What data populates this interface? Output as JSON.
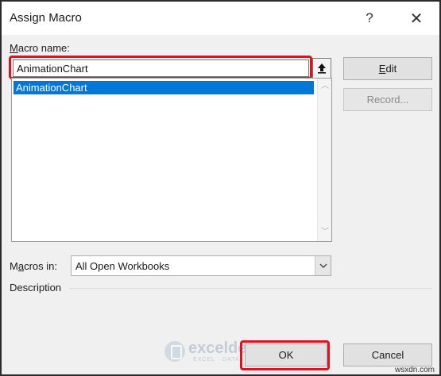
{
  "window": {
    "title": "Assign Macro",
    "help_glyph": "?",
    "close_glyph": "✕"
  },
  "macro_name": {
    "label": "Macro name:",
    "label_access_key": "M",
    "label_rest": "acro name:",
    "value": "AnimationChart"
  },
  "macro_list": {
    "items": [
      "AnimationChart"
    ],
    "selected_index": 0
  },
  "buttons": {
    "edit": "Edit",
    "edit_access_key": "E",
    "edit_rest": "dit",
    "record": "Record...",
    "ok": "OK",
    "cancel": "Cancel"
  },
  "macros_in": {
    "label": "Macros in:",
    "label_prefix": "M",
    "label_access_key": "a",
    "label_rest": "cros in:",
    "value": "All Open Workbooks"
  },
  "description": {
    "label": "Description"
  },
  "watermark": {
    "name": "exceldemy",
    "tagline": "EXCEL · DATA · BI"
  },
  "site_mark": "wsxdn.com",
  "colors": {
    "highlight": "#e3101f",
    "selection": "#0078d7",
    "dialog_bg": "#f0f0f0"
  },
  "icons": [
    "help-icon",
    "close-icon",
    "upload-arrow-icon",
    "scroll-up-icon",
    "scroll-down-icon",
    "dropdown-chevron-icon",
    "exceldemy-logo"
  ]
}
